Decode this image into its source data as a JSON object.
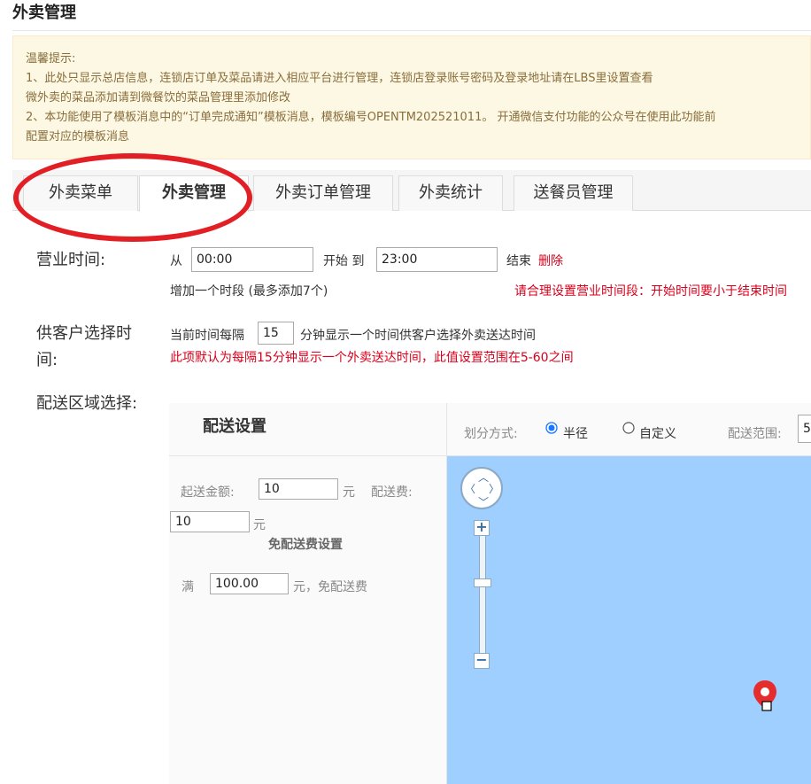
{
  "page_title": "外卖管理",
  "notice": {
    "heading": "温馨提示:",
    "line1": "1、此处只显示总店信息，连锁店订单及菜品请进入相应平台进行管理，连锁店登录账号密码及登录地址请在LBS里设置查看",
    "line2": "微外卖的菜品添加请到微餐饮的菜品管理里添加修改",
    "line3": "2、本功能使用了模板消息中的“订单完成通知”模板消息，模板编号OPENTM202521011。 开通微信支付功能的公众号在使用此功能前",
    "line4": "配置对应的模板消息"
  },
  "tabs": [
    {
      "label": "外卖菜单",
      "active": false
    },
    {
      "label": "外卖管理",
      "active": true
    },
    {
      "label": "外卖订单管理",
      "active": false
    },
    {
      "label": "外卖统计",
      "active": false
    },
    {
      "label": "送餐员管理",
      "active": false
    }
  ],
  "business_hours": {
    "label": "营业时间:",
    "from_label": "从",
    "start_value": "00:00",
    "start_to_label": "开始 到",
    "end_value": "23:00",
    "end_label": "结束",
    "delete_label": "删除",
    "add_slot_label": "增加一个时段 (最多添加7个)",
    "warning": "请合理设置营业时间段：开始时间要小于结束时间"
  },
  "customer_time": {
    "label_line1": "供客户选择时",
    "label_line2": "间:",
    "prefix": "当前时间每隔",
    "interval_value": "15",
    "suffix": "分钟显示一个时间供客户选择外卖送达时间",
    "note": "此项默认为每隔15分钟显示一个外卖送达时间，此值设置范围在5-60之间"
  },
  "delivery_area": {
    "label": "配送区域选择:",
    "settings_title": "配送设置",
    "divide_label": "划分方式:",
    "option_radius": "半径",
    "option_custom": "自定义",
    "selected_option": "半径",
    "range_label": "配送范围:",
    "range_value": "5",
    "min_amount_label": "起送金额:",
    "min_amount_value": "10",
    "yuan1": "元",
    "fee_label": "配送费:",
    "fee_value": "10",
    "yuan2": "元",
    "free_fee_title": "免配送费设置",
    "full_label": "满",
    "full_value": "100.00",
    "free_suffix": "元，免配送费"
  },
  "icons": [
    "map-nav-icon",
    "zoom-in-icon",
    "zoom-out-icon",
    "map-marker-icon"
  ],
  "colors": {
    "accent_red": "#d9001b",
    "map_water": "#9fcfff",
    "notice_bg": "#fcf8e3",
    "radio_blue": "#1677ff"
  }
}
